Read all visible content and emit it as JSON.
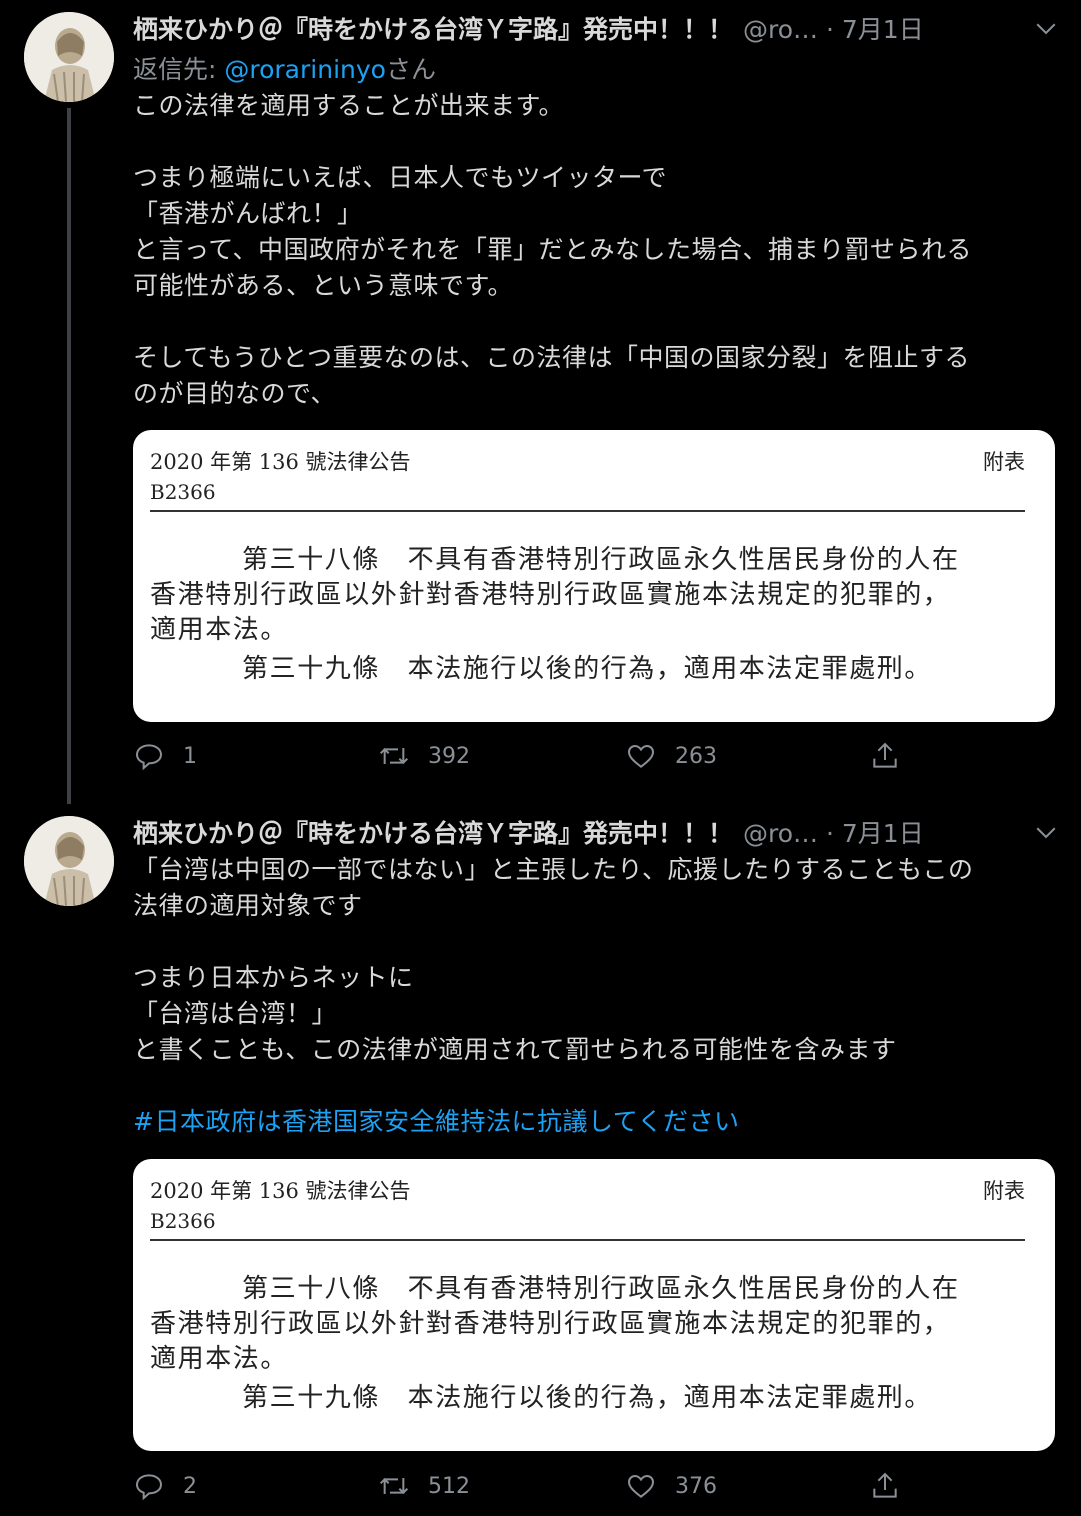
{
  "tweets": [
    {
      "name": "栖来ひかり＠『時をかける台湾Ｙ字路』発売中！！！",
      "handle_date": "@ro… · 7月1日",
      "reply_prefix": "返信先: ",
      "reply_handle": "@rorarininyo",
      "reply_suffix": "さん",
      "body": [
        "この法律を適用することが出来ます。",
        "",
        "つまり極端にいえば、日本人でもツイッターで",
        "「香港がんばれ！」",
        "と言って、中国政府がそれを「罪」だとみなした場合、捕まり罰せられる",
        "可能性がある、という意味です。",
        "",
        "そしてもうひとつ重要なのは、この法律は「中国の国家分裂」を阻止する",
        "のが目的なので、"
      ],
      "card": {
        "title": "2020 年第 136 號法律公告",
        "code": "B2366",
        "right": "附表",
        "art38_1": "第三十八條　不具有香港特別行政區永久性居民身份的人在",
        "art38_2": "香港特別行政區以外針對香港特別行政區實施本法規定的犯罪的，",
        "art38_3": "適用本法。",
        "art39": "第三十九條　本法施行以後的行為，適用本法定罪處刑。"
      },
      "actions": {
        "reply": "1",
        "retweet": "392",
        "like": "263"
      }
    },
    {
      "name": "栖来ひかり＠『時をかける台湾Ｙ字路』発売中！！！",
      "handle_date": "@ro… · 7月1日",
      "body": [
        "「台湾は中国の一部ではない」と主張したり、応援したりすることもこの",
        "法律の適用対象です",
        "",
        "つまり日本からネットに",
        "「台湾は台湾！」",
        "と書くことも、この法律が適用されて罰せられる可能性を含みます",
        ""
      ],
      "hashtag": "#日本政府は香港国家安全維持法に抗議してください",
      "card": {
        "title": "2020 年第 136 號法律公告",
        "code": "B2366",
        "right": "附表",
        "art38_1": "第三十八條　不具有香港特別行政區永久性居民身份的人在",
        "art38_2": "香港特別行政區以外針對香港特別行政區實施本法規定的犯罪的，",
        "art38_3": "適用本法。",
        "art39": "第三十九條　本法施行以後的行為，適用本法定罪處刑。"
      },
      "actions": {
        "reply": "2",
        "retweet": "512",
        "like": "376"
      }
    }
  ],
  "colors": {
    "background": "#000000",
    "text": "#d9d9d9",
    "muted": "#8b9096",
    "link": "#1da1f2",
    "thread_line": "#3d4145"
  },
  "icons": [
    "avatar",
    "chevron-down-icon",
    "reply-icon",
    "retweet-icon",
    "like-icon",
    "share-icon"
  ]
}
